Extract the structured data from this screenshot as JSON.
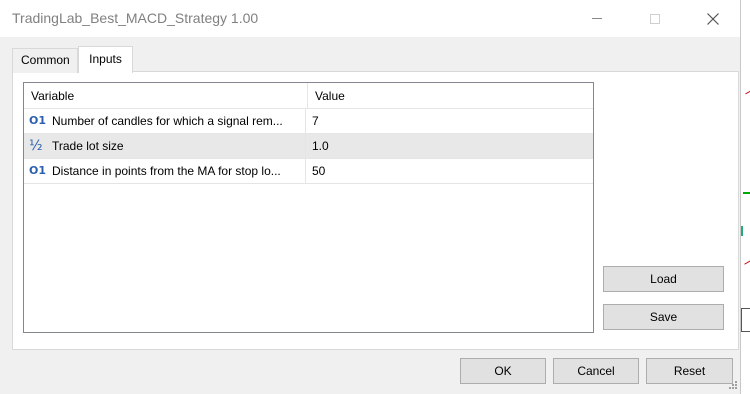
{
  "window": {
    "title": "TradingLab_Best_MACD_Strategy 1.00"
  },
  "tabs": [
    {
      "label": "Common",
      "active": false
    },
    {
      "label": "Inputs",
      "active": true
    }
  ],
  "grid": {
    "columns": [
      "Variable",
      "Value"
    ],
    "rows": [
      {
        "type_icon": "O1",
        "icon_name": "integer-icon",
        "variable": "Number of candles for which a signal rem...",
        "value": "7",
        "selected": false
      },
      {
        "type_icon": "½",
        "icon_name": "double-icon",
        "variable": "Trade lot size",
        "value": "1.0",
        "selected": true
      },
      {
        "type_icon": "O1",
        "icon_name": "integer-icon",
        "variable": "Distance in points from the MA for stop lo...",
        "value": "50",
        "selected": false
      }
    ]
  },
  "side_buttons": {
    "load": "Load",
    "save": "Save"
  },
  "footer_buttons": {
    "ok": "OK",
    "cancel": "Cancel",
    "reset": "Reset"
  },
  "colors": {
    "type_icon": "#2b5fae",
    "selected_row": "#e8e8e8",
    "title_text": "#808080"
  }
}
